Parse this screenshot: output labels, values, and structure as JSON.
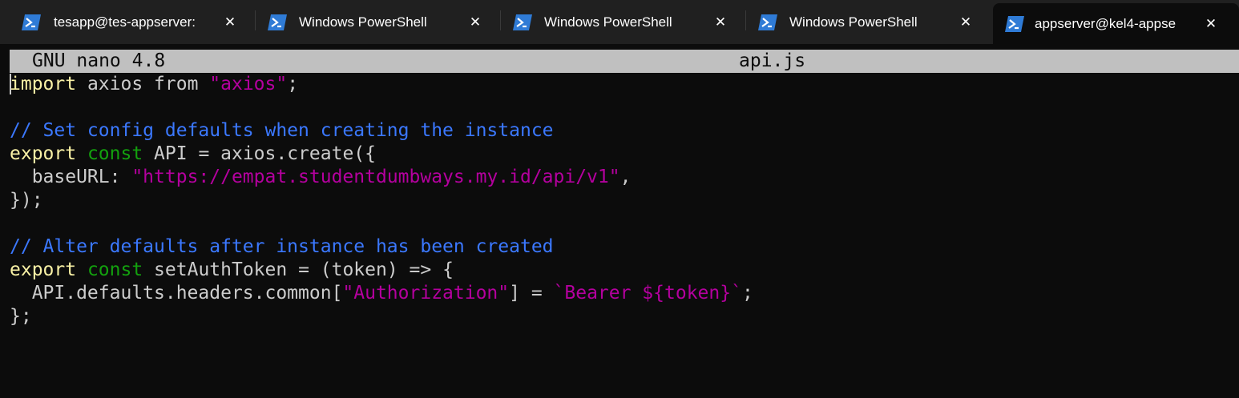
{
  "tabs": [
    {
      "title": "tesapp@tes-appserver:",
      "icon": "powershell-icon",
      "active": false
    },
    {
      "title": "Windows PowerShell",
      "icon": "powershell-icon",
      "active": false
    },
    {
      "title": "Windows PowerShell",
      "icon": "powershell-icon",
      "active": false
    },
    {
      "title": "Windows PowerShell",
      "icon": "powershell-icon",
      "active": false
    },
    {
      "title": "appserver@kel4-appse",
      "icon": "powershell-icon",
      "active": true
    }
  ],
  "tab_close_glyph": "✕",
  "nano": {
    "version_label": "GNU nano 4.8",
    "filename": "api.js"
  },
  "code": {
    "l1": {
      "a": "import",
      "b": " axios ",
      "c": "from",
      "d": " ",
      "e": "\"axios\"",
      "f": ";"
    },
    "l3": {
      "a": "// Set config defaults when creating the instance"
    },
    "l4": {
      "a": "export",
      "b": " ",
      "c": "const",
      "d": " API = axios.create({"
    },
    "l5": {
      "a": "  baseURL: ",
      "b": "\"https://empat.studentdumbways.my.id/api/v1\"",
      "c": ","
    },
    "l6": {
      "a": "});"
    },
    "l8": {
      "a": "// Alter defaults after instance has been created"
    },
    "l9": {
      "a": "export",
      "b": " ",
      "c": "const",
      "d": " setAuthToken = (token) => {"
    },
    "l10": {
      "a": "  API.defaults.headers.common[",
      "b": "\"Authorization\"",
      "c": "] = ",
      "d": "`Bearer ${token}`",
      "e": ";"
    },
    "l11": {
      "a": "};"
    }
  },
  "colors": {
    "background": "#0c0c0c",
    "tabbar": "#202020",
    "keyword_yellow": "#f9f1a5",
    "keyword_green": "#13a10e",
    "comment_blue": "#3b78ff",
    "string_magenta": "#b4009e",
    "plain": "#cccccc",
    "titlebar": "#c0c0c0",
    "powershell_icon": "#2f7bd6"
  }
}
